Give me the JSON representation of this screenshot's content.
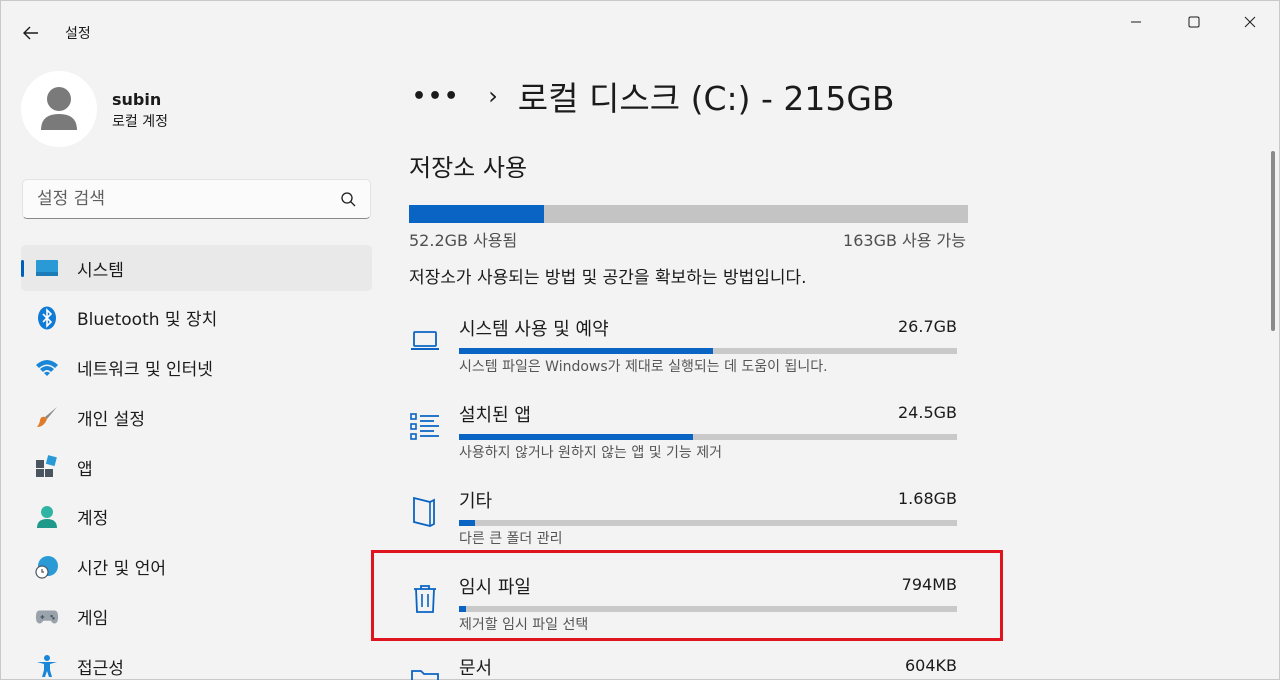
{
  "titlebar": {
    "app_title": "설정"
  },
  "profile": {
    "name": "subin",
    "account_type": "로컬 계정"
  },
  "search": {
    "placeholder": "설정 검색"
  },
  "sidebar": {
    "items": [
      {
        "label": "시스템",
        "icon": "system-icon",
        "selected": true
      },
      {
        "label": "Bluetooth 및 장치",
        "icon": "bluetooth-icon"
      },
      {
        "label": "네트워크 및 인터넷",
        "icon": "wifi-icon"
      },
      {
        "label": "개인 설정",
        "icon": "brush-icon"
      },
      {
        "label": "앱",
        "icon": "apps-icon"
      },
      {
        "label": "계정",
        "icon": "account-icon"
      },
      {
        "label": "시간 및 언어",
        "icon": "globe-clock-icon"
      },
      {
        "label": "게임",
        "icon": "gamepad-icon"
      },
      {
        "label": "접근성",
        "icon": "accessibility-icon"
      }
    ]
  },
  "breadcrumb": {
    "more": "•••",
    "separator": "›",
    "title": "로컬 디스크 (C:) - 215GB"
  },
  "storage": {
    "section_title": "저장소 사용",
    "used_fraction": 0.242,
    "used_label": "52.2GB 사용됨",
    "free_label": "163GB 사용 가능",
    "description": "저장소가 사용되는 방법 및 공간을 확보하는 방법입니다.",
    "categories": [
      {
        "name": "시스템 사용 및 예약",
        "size": "26.7GB",
        "fraction": 0.51,
        "desc": "시스템 파일은 Windows가 제대로 실행되는 데 도움이 됩니다.",
        "icon": "laptop-icon"
      },
      {
        "name": "설치된 앱",
        "size": "24.5GB",
        "fraction": 0.47,
        "desc": "사용하지 않거나 원하지 않는 앱 및 기능 제거",
        "icon": "app-list-icon"
      },
      {
        "name": "기타",
        "size": "1.68GB",
        "fraction": 0.032,
        "desc": "다른 큰 폴더 관리",
        "icon": "folder-outline-icon"
      },
      {
        "name": "임시 파일",
        "size": "794MB",
        "fraction": 0.015,
        "desc": "제거할 임시 파일 선택",
        "icon": "trash-icon"
      },
      {
        "name": "문서",
        "size": "604KB",
        "fraction": 0.0,
        "desc": "",
        "icon": "documents-folder-icon"
      }
    ]
  },
  "colors": {
    "accent": "#0a64c3",
    "highlight": "#e0141e"
  }
}
